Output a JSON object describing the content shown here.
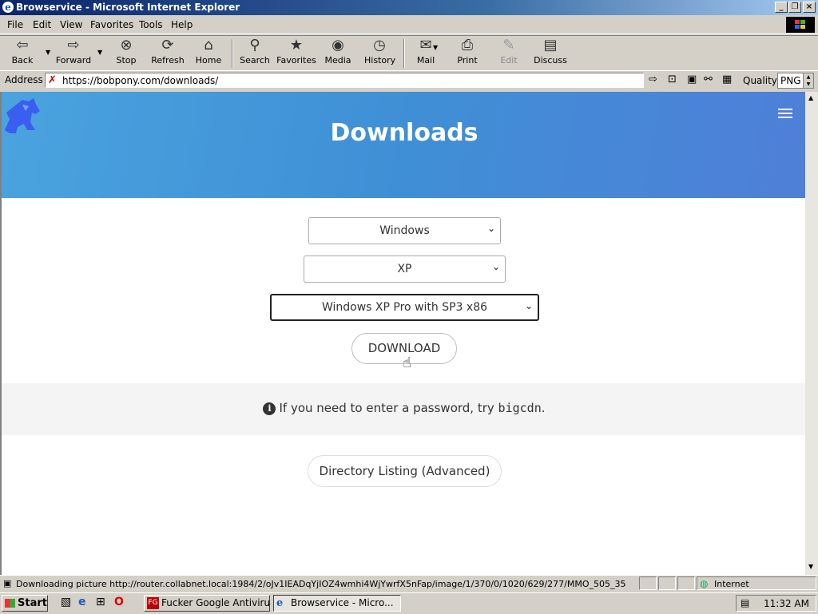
{
  "window": {
    "title": "Browservice - Microsoft Internet Explorer",
    "controls": [
      "minimize",
      "restore",
      "close"
    ]
  },
  "menu": [
    "File",
    "Edit",
    "View",
    "Favorites",
    "Tools",
    "Help"
  ],
  "toolbar": {
    "back": "Back",
    "forward": "Forward",
    "stop": "Stop",
    "refresh": "Refresh",
    "home": "Home",
    "search": "Search",
    "favorites": "Favorites",
    "media": "Media",
    "history": "History",
    "mail": "Mail",
    "print": "Print",
    "edit": "Edit",
    "discuss": "Discuss"
  },
  "address": {
    "label": "Address",
    "url": "https://bobpony.com/downloads/",
    "quality_label": "Quality",
    "quality_value": "PNG"
  },
  "page": {
    "hero_title": "Downloads",
    "os_select": "Windows",
    "version_select": "XP",
    "edition_select": "Windows XP Pro with SP3 x86",
    "download_button": "DOWNLOAD",
    "info_prefix": "If you need to enter a password, try",
    "info_code": "bigcdn",
    "info_suffix": ".",
    "directory_button": "Directory Listing (Advanced)"
  },
  "status": {
    "text": "Downloading picture http://router.collabnet.local:1984/2/oJv1IEADqYjIOZ4wmhi4WjYwrfX5nFap/image/1/370/0/1020/629/277/MMO_505_35",
    "zone": "Internet"
  },
  "taskbar": {
    "start": "Start",
    "tasks": [
      {
        "label": "Fucker Google Antiviru...",
        "icon": "fg-app-icon",
        "active": false
      },
      {
        "label": "Browservice - Micro...",
        "icon": "ie-icon",
        "active": true
      }
    ],
    "clock": "11:32 AM"
  },
  "colors": {
    "hero_gradient_start": "#4aa3de",
    "hero_gradient_end": "#4f7fd8",
    "title_bar": "#0a246a"
  }
}
